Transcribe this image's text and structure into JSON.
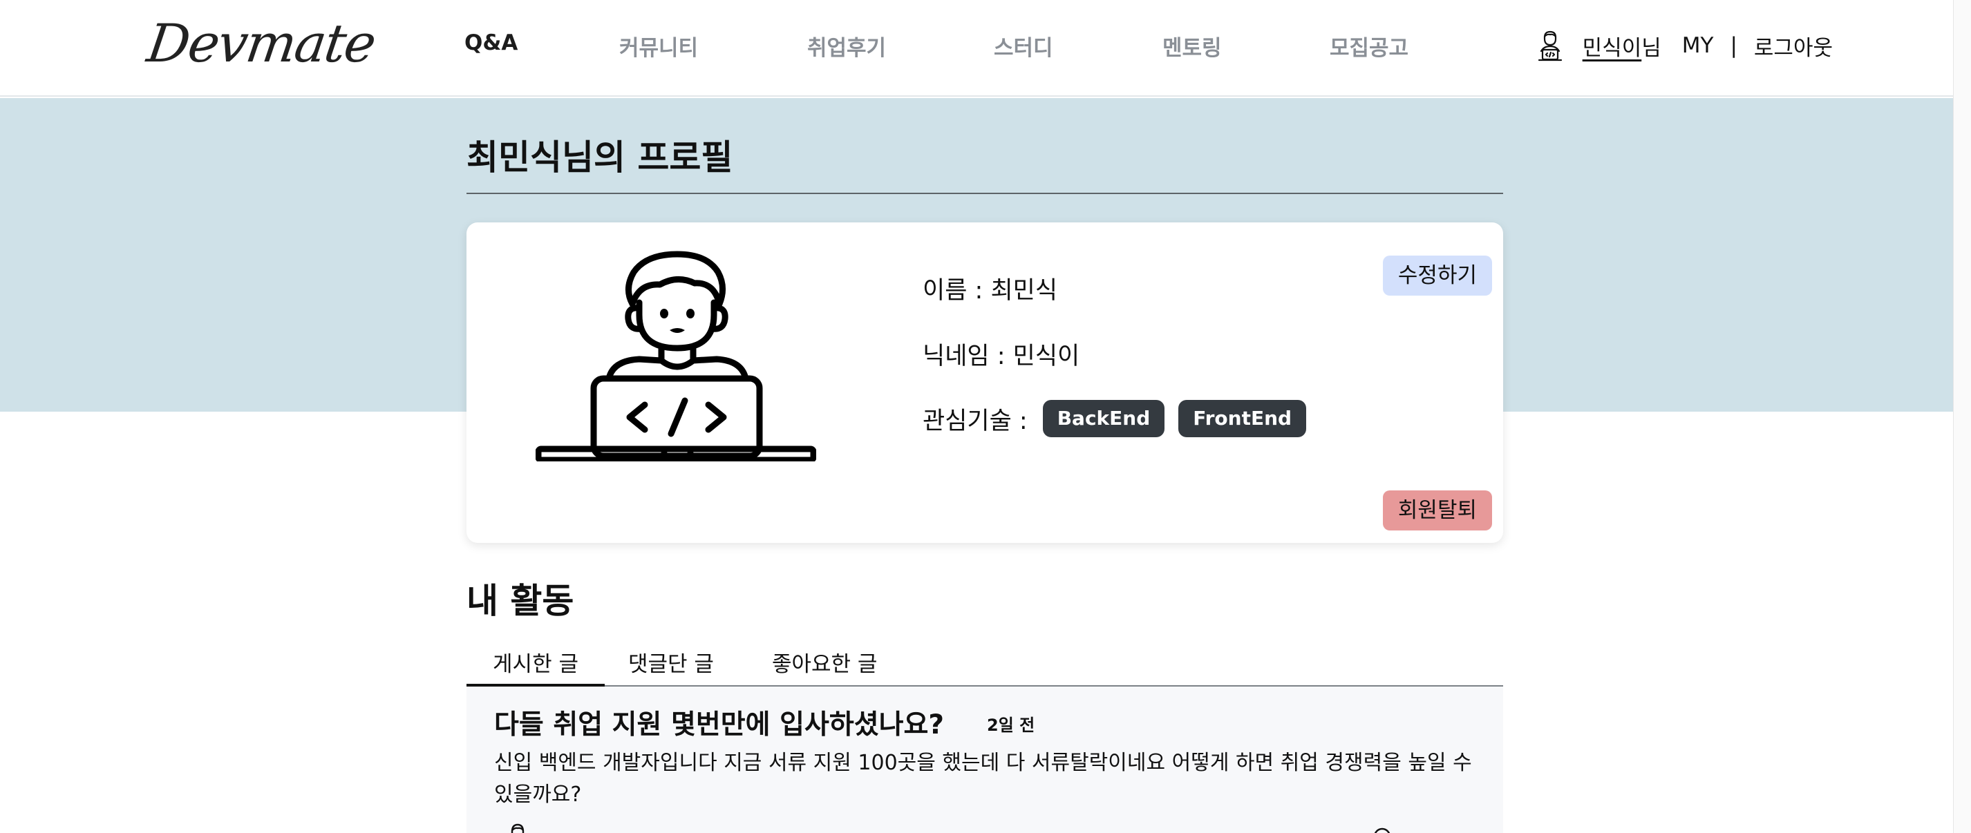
{
  "header": {
    "logo": "Devmate",
    "nav": [
      {
        "label": "Q&A",
        "active": true
      },
      {
        "label": "커뮤니티",
        "active": false
      },
      {
        "label": "취업후기",
        "active": false
      },
      {
        "label": "스터디",
        "active": false
      },
      {
        "label": "멘토링",
        "active": false
      },
      {
        "label": "모집공고",
        "active": false
      }
    ],
    "user": {
      "avatar_icon": "developer-avatar-icon",
      "name": "민식이",
      "suffix": "님",
      "my": "MY",
      "separator": "|",
      "logout": "로그아웃"
    }
  },
  "profile": {
    "title": "최민식님의 프로필",
    "illustration_icon": "developer-laptop-icon",
    "name_row": "이름 : 최민식",
    "nickname_row": "닉네임 : 민식이",
    "interest_label": "관심기술 :",
    "tags": [
      "BackEnd",
      "FrontEnd"
    ],
    "edit_label": "수정하기",
    "withdraw_label": "회원탈퇴"
  },
  "activity": {
    "title": "내 활동",
    "tabs": [
      {
        "label": "게시한 글",
        "active": true
      },
      {
        "label": "댓글단 글",
        "active": false
      },
      {
        "label": "좋아요한 글",
        "active": false
      }
    ],
    "posts": [
      {
        "title": "다들 취업 지원 몇번만에 입사하셨나요?",
        "time": "2일 전",
        "body": "신입 백엔드 개발자입니다 지금 서류 지원 100곳을 했는데 다 서류탈락이네요 어떻게 하면 취업 경쟁력을 높일 수 있을까요?"
      }
    ]
  },
  "colors": {
    "banner": "#cfe1e8",
    "edit_button": "#d3e0fc",
    "withdraw_button": "#e79999",
    "tag": "#343a40",
    "post_background": "#f7f8fa"
  }
}
